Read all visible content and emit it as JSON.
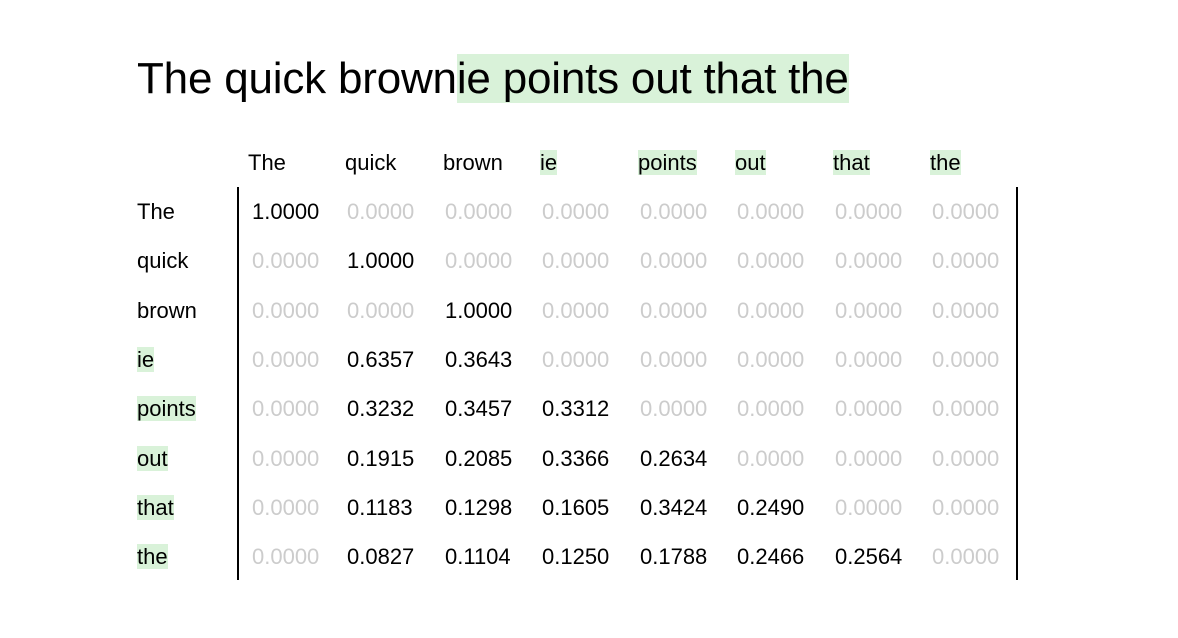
{
  "title": {
    "prefix": "The quick brown",
    "highlighted": "ie points out that the"
  },
  "highlight_color": "#d9f2d9",
  "zero_color": "#cccccc",
  "tokens": [
    {
      "text": "The",
      "highlighted": false
    },
    {
      "text": "quick",
      "highlighted": false
    },
    {
      "text": "brown",
      "highlighted": false
    },
    {
      "text": "ie",
      "highlighted": true
    },
    {
      "text": "points",
      "highlighted": true
    },
    {
      "text": "out",
      "highlighted": true
    },
    {
      "text": "that",
      "highlighted": true
    },
    {
      "text": "the",
      "highlighted": true
    }
  ],
  "matrix": [
    [
      "1.0000",
      "0.0000",
      "0.0000",
      "0.0000",
      "0.0000",
      "0.0000",
      "0.0000",
      "0.0000"
    ],
    [
      "0.0000",
      "1.0000",
      "0.0000",
      "0.0000",
      "0.0000",
      "0.0000",
      "0.0000",
      "0.0000"
    ],
    [
      "0.0000",
      "0.0000",
      "1.0000",
      "0.0000",
      "0.0000",
      "0.0000",
      "0.0000",
      "0.0000"
    ],
    [
      "0.0000",
      "0.6357",
      "0.3643",
      "0.0000",
      "0.0000",
      "0.0000",
      "0.0000",
      "0.0000"
    ],
    [
      "0.0000",
      "0.3232",
      "0.3457",
      "0.3312",
      "0.0000",
      "0.0000",
      "0.0000",
      "0.0000"
    ],
    [
      "0.0000",
      "0.1915",
      "0.2085",
      "0.3366",
      "0.2634",
      "0.0000",
      "0.0000",
      "0.0000"
    ],
    [
      "0.0000",
      "0.1183",
      "0.1298",
      "0.1605",
      "0.3424",
      "0.2490",
      "0.0000",
      "0.0000"
    ],
    [
      "0.0000",
      "0.0827",
      "0.1104",
      "0.1250",
      "0.1788",
      "0.2466",
      "0.2564",
      "0.0000"
    ]
  ]
}
